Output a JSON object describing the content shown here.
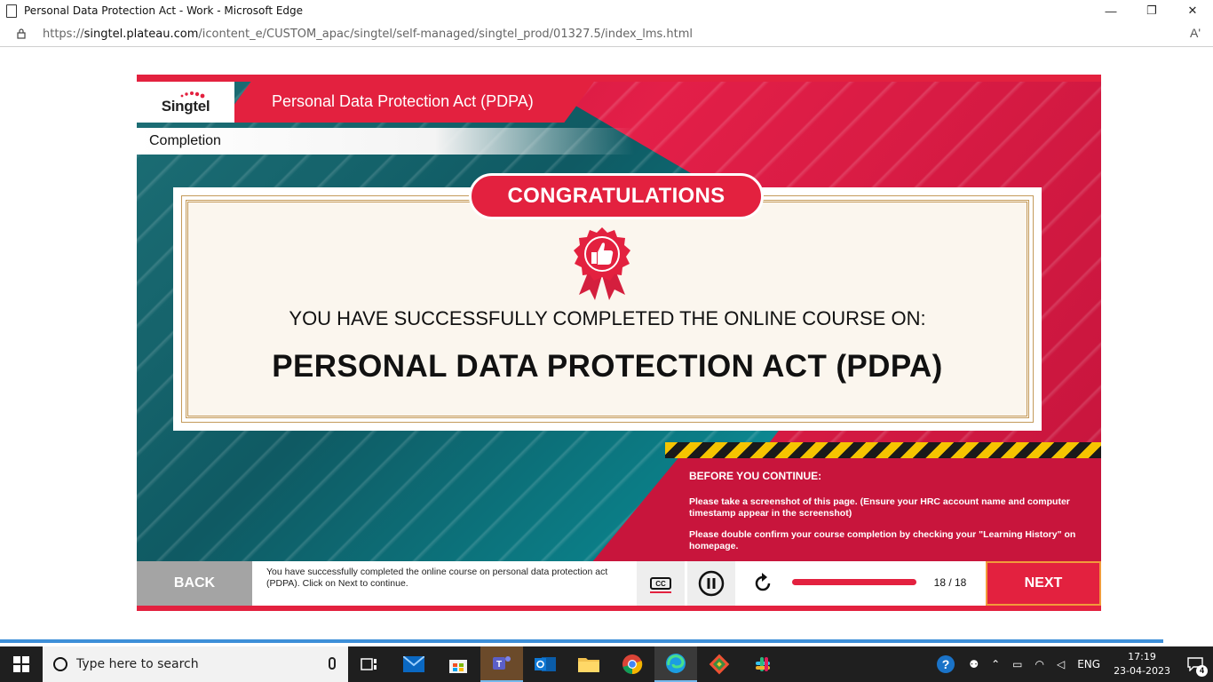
{
  "browser": {
    "window_title": "Personal Data Protection Act - Work - Microsoft Edge",
    "url_prefix": "https://",
    "url_host": "singtel.plateau.com",
    "url_path": "/icontent_e/CUSTOM_apac/singtel/self-managed/singtel_prod/01327.5/index_lms.html",
    "read_aloud_label": "Aʹ",
    "minimize_glyph": "—",
    "restore_glyph": "❐",
    "close_glyph": "✕"
  },
  "course": {
    "logo": "Singtel",
    "header_title": "Personal Data Protection Act (PDPA)",
    "section": "Completion",
    "congrats_label": "CONGRATULATIONS",
    "completed_line": "YOU HAVE SUCCESSFULLY COMPLETED THE ONLINE COURSE ON:",
    "course_name": "PERSONAL DATA PROTECTION ACT (PDPA)",
    "before_title": "BEFORE YOU CONTINUE:",
    "before_p1": "Please take a screenshot of this page. (Ensure your  HRC account name and computer timestamp appear in the screenshot)",
    "before_p2": "Please double confirm your course completion by checking your \"Learning History\" on homepage.",
    "controls": {
      "back_label": "BACK",
      "caption": "You have successfully completed the online course on personal data protection act (PDPA). Click on Next to continue.",
      "cc_label": "CC",
      "page_counter": "18 / 18",
      "progress_fraction": 1.0,
      "next_label": "NEXT"
    }
  },
  "colors": {
    "brand_red": "#e3213f",
    "teal": "#0f5a63",
    "gold_border": "#c49a5a"
  },
  "taskbar": {
    "search_placeholder": "Type here to search",
    "language": "ENG",
    "time": "17:19",
    "date": "23-04-2023",
    "notification_count": "4",
    "apps": [
      "task-view-icon",
      "mail-icon",
      "store-icon",
      "teams-icon",
      "outlook-icon",
      "file-explorer-icon",
      "chrome-icon",
      "edge-icon",
      "git-icon",
      "slack-icon"
    ]
  }
}
